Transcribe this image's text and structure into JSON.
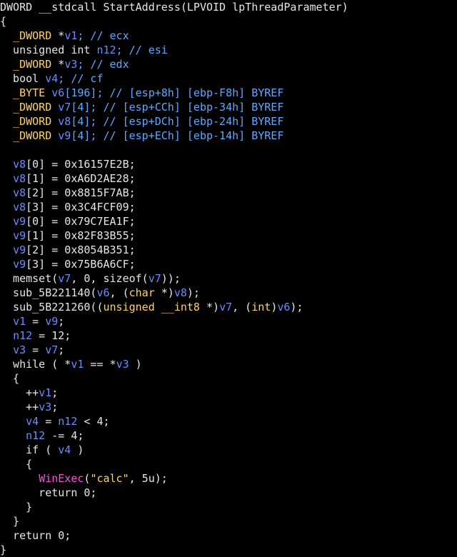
{
  "lines": [
    [
      {
        "t": "DWORD __stdcall StartAddress(LPVOID lpThreadParameter)",
        "c": "c-white"
      }
    ],
    [
      {
        "t": "{",
        "c": "c-white"
      }
    ],
    [
      {
        "t": "  ",
        "c": "c-white"
      },
      {
        "t": "_DWORD",
        "c": "c-yellow"
      },
      {
        "t": " *",
        "c": "c-white"
      },
      {
        "t": "v1",
        "c": "c-var"
      },
      {
        "t": "; // ecx",
        "c": "c-comment"
      }
    ],
    [
      {
        "t": "  unsigned int ",
        "c": "c-white"
      },
      {
        "t": "n12",
        "c": "c-var"
      },
      {
        "t": "; // esi",
        "c": "c-comment"
      }
    ],
    [
      {
        "t": "  ",
        "c": "c-white"
      },
      {
        "t": "_DWORD",
        "c": "c-yellow"
      },
      {
        "t": " *",
        "c": "c-white"
      },
      {
        "t": "v3",
        "c": "c-var"
      },
      {
        "t": "; // edx",
        "c": "c-comment"
      }
    ],
    [
      {
        "t": "  bool ",
        "c": "c-white"
      },
      {
        "t": "v4",
        "c": "c-var"
      },
      {
        "t": "; // cf",
        "c": "c-comment"
      }
    ],
    [
      {
        "t": "  ",
        "c": "c-white"
      },
      {
        "t": "_BYTE",
        "c": "c-yellow"
      },
      {
        "t": " ",
        "c": "c-white"
      },
      {
        "t": "v6",
        "c": "c-var"
      },
      {
        "t": "[196]; // [esp+8h] [ebp-F8h] BYREF",
        "c": "c-comment"
      }
    ],
    [
      {
        "t": "  ",
        "c": "c-white"
      },
      {
        "t": "_DWORD",
        "c": "c-yellow"
      },
      {
        "t": " ",
        "c": "c-white"
      },
      {
        "t": "v7",
        "c": "c-var"
      },
      {
        "t": "[4]; // [esp+CCh] [ebp-34h] BYREF",
        "c": "c-comment"
      }
    ],
    [
      {
        "t": "  ",
        "c": "c-white"
      },
      {
        "t": "_DWORD",
        "c": "c-yellow"
      },
      {
        "t": " ",
        "c": "c-white"
      },
      {
        "t": "v8",
        "c": "c-var"
      },
      {
        "t": "[4]; // [esp+DCh] [ebp-24h] BYREF",
        "c": "c-comment"
      }
    ],
    [
      {
        "t": "  ",
        "c": "c-white"
      },
      {
        "t": "_DWORD",
        "c": "c-yellow"
      },
      {
        "t": " ",
        "c": "c-white"
      },
      {
        "t": "v9",
        "c": "c-var"
      },
      {
        "t": "[4]; // [esp+ECh] [ebp-14h] BYREF",
        "c": "c-comment"
      }
    ],
    [
      {
        "t": "",
        "c": "c-white"
      }
    ],
    [
      {
        "t": "  ",
        "c": "c-white"
      },
      {
        "t": "v8",
        "c": "c-var"
      },
      {
        "t": "[0] = 0x16157E2B;",
        "c": "c-white"
      }
    ],
    [
      {
        "t": "  ",
        "c": "c-white"
      },
      {
        "t": "v8",
        "c": "c-var"
      },
      {
        "t": "[1] = 0xA6D2AE28;",
        "c": "c-white"
      }
    ],
    [
      {
        "t": "  ",
        "c": "c-white"
      },
      {
        "t": "v8",
        "c": "c-var"
      },
      {
        "t": "[2] = 0x8815F7AB;",
        "c": "c-white"
      }
    ],
    [
      {
        "t": "  ",
        "c": "c-white"
      },
      {
        "t": "v8",
        "c": "c-var"
      },
      {
        "t": "[3] = 0x3C4FCF09;",
        "c": "c-white"
      }
    ],
    [
      {
        "t": "  ",
        "c": "c-white"
      },
      {
        "t": "v9",
        "c": "c-var"
      },
      {
        "t": "[0] = 0x79C7EA1F;",
        "c": "c-white"
      }
    ],
    [
      {
        "t": "  ",
        "c": "c-white"
      },
      {
        "t": "v9",
        "c": "c-var"
      },
      {
        "t": "[1] = 0x82F83B55;",
        "c": "c-white"
      }
    ],
    [
      {
        "t": "  ",
        "c": "c-white"
      },
      {
        "t": "v9",
        "c": "c-var"
      },
      {
        "t": "[2] = 0x8054B351;",
        "c": "c-white"
      }
    ],
    [
      {
        "t": "  ",
        "c": "c-white"
      },
      {
        "t": "v9",
        "c": "c-var"
      },
      {
        "t": "[3] = 0x75B6A6CF;",
        "c": "c-white"
      }
    ],
    [
      {
        "t": "  memset(",
        "c": "c-white"
      },
      {
        "t": "v7",
        "c": "c-var"
      },
      {
        "t": ", 0, sizeof(",
        "c": "c-white"
      },
      {
        "t": "v7",
        "c": "c-var"
      },
      {
        "t": "));",
        "c": "c-white"
      }
    ],
    [
      {
        "t": "  sub_5B221140(",
        "c": "c-white"
      },
      {
        "t": "v6",
        "c": "c-var"
      },
      {
        "t": ", (",
        "c": "c-white"
      },
      {
        "t": "char",
        "c": "c-yellow"
      },
      {
        "t": " *)",
        "c": "c-white"
      },
      {
        "t": "v8",
        "c": "c-var"
      },
      {
        "t": ");",
        "c": "c-white"
      }
    ],
    [
      {
        "t": "  sub_5B221260((",
        "c": "c-white"
      },
      {
        "t": "unsigned __int8",
        "c": "c-yellow"
      },
      {
        "t": " *)",
        "c": "c-white"
      },
      {
        "t": "v7",
        "c": "c-var"
      },
      {
        "t": ", (",
        "c": "c-white"
      },
      {
        "t": "int",
        "c": "c-yellow"
      },
      {
        "t": ")",
        "c": "c-white"
      },
      {
        "t": "v6",
        "c": "c-var"
      },
      {
        "t": ");",
        "c": "c-white"
      }
    ],
    [
      {
        "t": "  ",
        "c": "c-white"
      },
      {
        "t": "v1",
        "c": "c-var"
      },
      {
        "t": " = ",
        "c": "c-white"
      },
      {
        "t": "v9",
        "c": "c-var"
      },
      {
        "t": ";",
        "c": "c-white"
      }
    ],
    [
      {
        "t": "  ",
        "c": "c-white"
      },
      {
        "t": "n12",
        "c": "c-var"
      },
      {
        "t": " = 12;",
        "c": "c-white"
      }
    ],
    [
      {
        "t": "  ",
        "c": "c-white"
      },
      {
        "t": "v3",
        "c": "c-var"
      },
      {
        "t": " = ",
        "c": "c-white"
      },
      {
        "t": "v7",
        "c": "c-var"
      },
      {
        "t": ";",
        "c": "c-white"
      }
    ],
    [
      {
        "t": "  while ( *",
        "c": "c-white"
      },
      {
        "t": "v1",
        "c": "c-var"
      },
      {
        "t": " == *",
        "c": "c-white"
      },
      {
        "t": "v3",
        "c": "c-var"
      },
      {
        "t": " )",
        "c": "c-white"
      }
    ],
    [
      {
        "t": "  {",
        "c": "c-white"
      }
    ],
    [
      {
        "t": "    ++",
        "c": "c-white"
      },
      {
        "t": "v1",
        "c": "c-var"
      },
      {
        "t": ";",
        "c": "c-white"
      }
    ],
    [
      {
        "t": "    ++",
        "c": "c-white"
      },
      {
        "t": "v3",
        "c": "c-var"
      },
      {
        "t": ";",
        "c": "c-white"
      }
    ],
    [
      {
        "t": "    ",
        "c": "c-white"
      },
      {
        "t": "v4",
        "c": "c-var"
      },
      {
        "t": " = ",
        "c": "c-white"
      },
      {
        "t": "n12",
        "c": "c-var"
      },
      {
        "t": " < 4;",
        "c": "c-white"
      }
    ],
    [
      {
        "t": "    ",
        "c": "c-white"
      },
      {
        "t": "n12",
        "c": "c-var"
      },
      {
        "t": " -= 4;",
        "c": "c-white"
      }
    ],
    [
      {
        "t": "    if ( ",
        "c": "c-white"
      },
      {
        "t": "v4",
        "c": "c-var"
      },
      {
        "t": " )",
        "c": "c-white"
      }
    ],
    [
      {
        "t": "    {",
        "c": "c-white"
      }
    ],
    [
      {
        "t": "      ",
        "c": "c-white"
      },
      {
        "t": "WinExec",
        "c": "c-pink"
      },
      {
        "t": "(",
        "c": "c-white"
      },
      {
        "t": "\"calc\"",
        "c": "c-yellow"
      },
      {
        "t": ", 5u);",
        "c": "c-white"
      }
    ],
    [
      {
        "t": "      return 0;",
        "c": "c-white"
      }
    ],
    [
      {
        "t": "    }",
        "c": "c-white"
      }
    ],
    [
      {
        "t": "  }",
        "c": "c-white"
      }
    ],
    [
      {
        "t": "  return 0;",
        "c": "c-white"
      }
    ],
    [
      {
        "t": "}",
        "c": "c-white"
      }
    ]
  ]
}
